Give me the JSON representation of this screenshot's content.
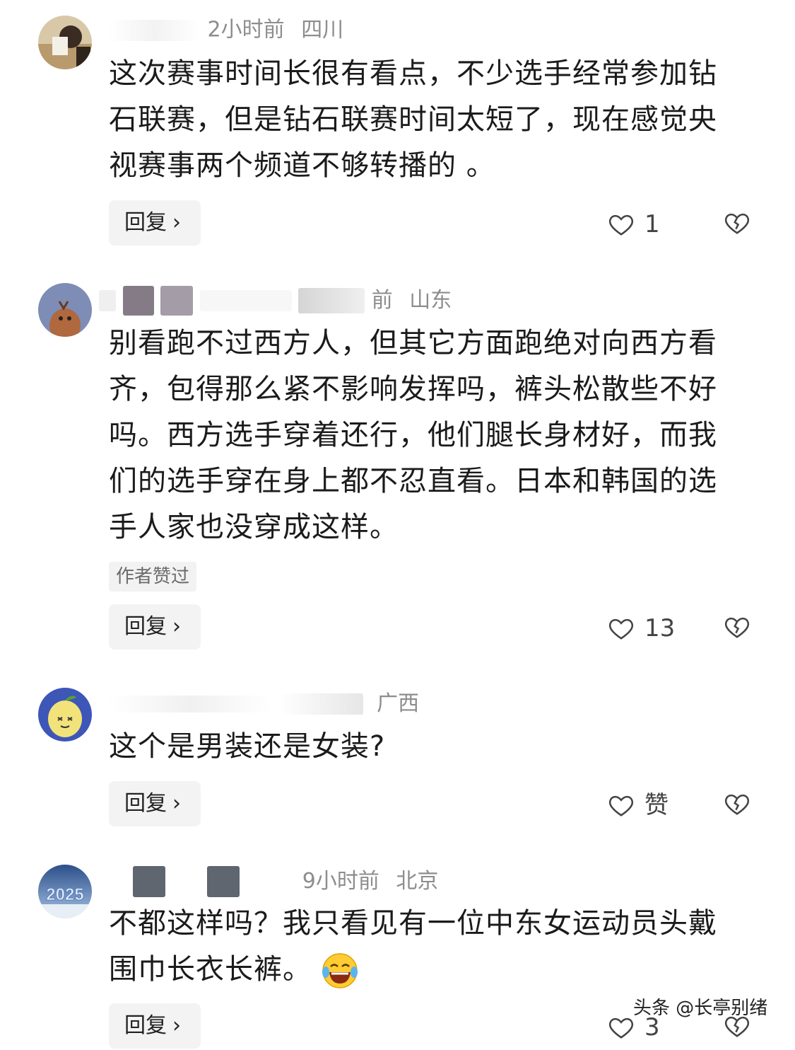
{
  "comments": [
    {
      "meta_time": "2小时前",
      "meta_region": "四川",
      "lines": [
        "这次赛事时间长很有看点，不少选手经常参加钻",
        "石联赛，但是钻石联赛时间太短了，现在感觉央",
        "视赛事两个频道不够转播的 。"
      ],
      "reply_label": "回复",
      "like_count": "1"
    },
    {
      "meta_time": "前",
      "meta_region": "山东",
      "lines": [
        "别看跑不过西方人，但其它方面跑绝对向西方看",
        "齐，包得那么紧不影响发挥吗，裤头松散些不好",
        "吗。西方选手穿着还行，他们腿长身材好，而我",
        "们的选手穿在身上都不忍直看。日本和韩国的选",
        "手人家也没穿成这样。"
      ],
      "badge": "作者赞过",
      "reply_label": "回复",
      "like_count": "13"
    },
    {
      "meta_time": "",
      "meta_region": "广西",
      "lines": [
        "这个是男装还是女装?"
      ],
      "reply_label": "回复",
      "like_count": "赞"
    },
    {
      "meta_time": "9小时前",
      "meta_region": "北京",
      "lines": [
        "不都这样吗？我只看见有一位中东女运动员头戴",
        "围巾长衣长裤。"
      ],
      "reply_label": "回复",
      "like_count": "3"
    }
  ],
  "avatar_text": "2025",
  "icons": {
    "like": "heart-outline-icon",
    "dislike": "broken-heart-icon",
    "chevron": "chevron-right-icon",
    "emoji": "laughing-tears-emoji-icon"
  },
  "watermark": "头条 @长亭别绪",
  "colors": {
    "meta": "#8d8d8d",
    "button_bg": "#f3f3f3",
    "text": "#1b1b1b"
  }
}
